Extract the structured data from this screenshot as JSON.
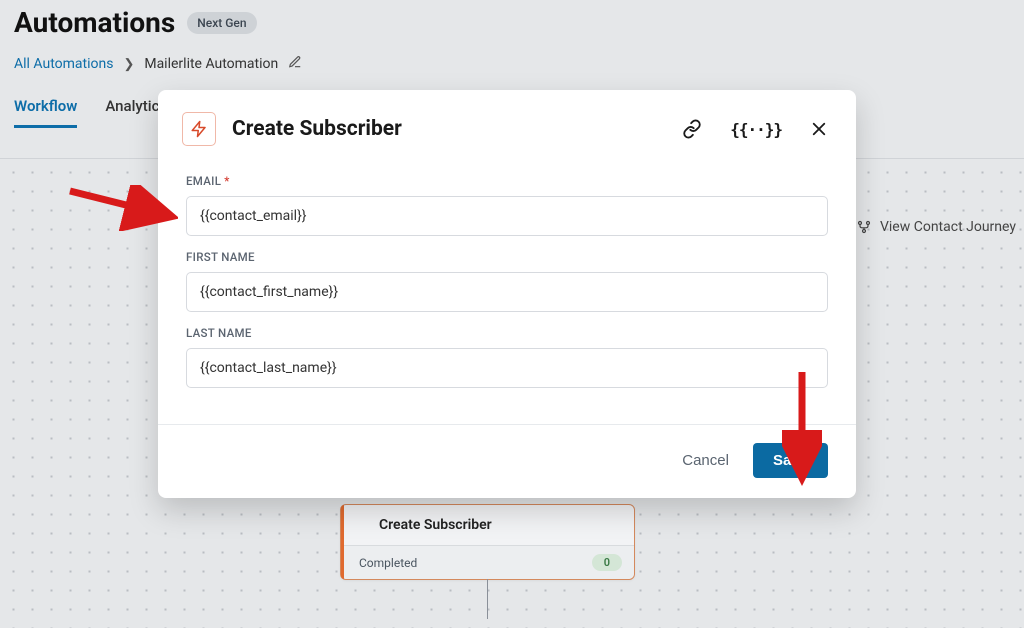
{
  "header": {
    "title": "Automations",
    "badge": "Next Gen"
  },
  "breadcrumb": {
    "root": "All Automations",
    "current": "Mailerlite Automation"
  },
  "tabs": {
    "workflow": "Workflow",
    "analytics": "Analytics"
  },
  "canvas": {
    "viewJourney": "View Contact Journey",
    "node": {
      "title": "Create Subscriber",
      "status": "Completed",
      "count": "0"
    }
  },
  "modal": {
    "title": "Create Subscriber",
    "fields": {
      "email": {
        "label": "EMAIL",
        "value": "{{contact_email}}",
        "required": true
      },
      "firstName": {
        "label": "FIRST NAME",
        "value": "{{contact_first_name}}"
      },
      "lastName": {
        "label": "LAST NAME",
        "value": "{{contact_last_name}}"
      }
    },
    "actions": {
      "cancel": "Cancel",
      "save": "Save"
    }
  }
}
